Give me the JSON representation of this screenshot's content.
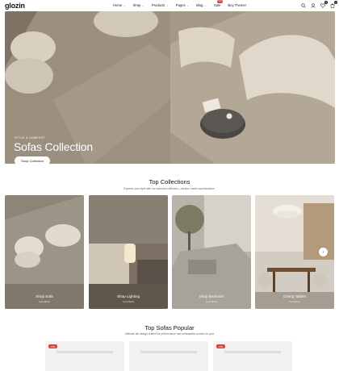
{
  "header": {
    "logo_text": "glozin",
    "nav": [
      {
        "label": "Home",
        "chevron": true
      },
      {
        "label": "Shop",
        "chevron": true
      },
      {
        "label": "Products",
        "chevron": true
      },
      {
        "label": "Pages",
        "chevron": true
      },
      {
        "label": "Blog",
        "chevron": true
      },
      {
        "label": "Sale",
        "chevron": false,
        "badge": "Hot"
      },
      {
        "label": "Buy Theme!",
        "chevron": false
      }
    ],
    "icons": [
      "search-icon",
      "user-icon",
      "wishlist-icon",
      "cart-icon"
    ],
    "wishlist_count": "0",
    "cart_count": "0"
  },
  "hero": {
    "subtitle": "Style & Comfort",
    "title": "Sofas Collection",
    "button_label": "Shop Collection"
  },
  "collections": {
    "title": "Top Collections",
    "description": "Express your style with our standout collection—fashion meets sophistication.",
    "items": [
      {
        "name": "Shop Sofa",
        "count": "3 products"
      },
      {
        "name": "Shop Lighting",
        "count": "3 products"
      },
      {
        "name": "Shop Bedroom",
        "count": "3 products"
      },
      {
        "name": "Dining Tables",
        "count": "3 products"
      }
    ],
    "next_arrow": "›"
  },
  "popular": {
    "title": "Top Sofas Popular",
    "description": "Ultimate fab design crafted for performance and unbeatable comfort on your",
    "sale_badge": "-15%"
  },
  "colors": {
    "accent": "#c39a54",
    "sale": "#e23b3b"
  }
}
